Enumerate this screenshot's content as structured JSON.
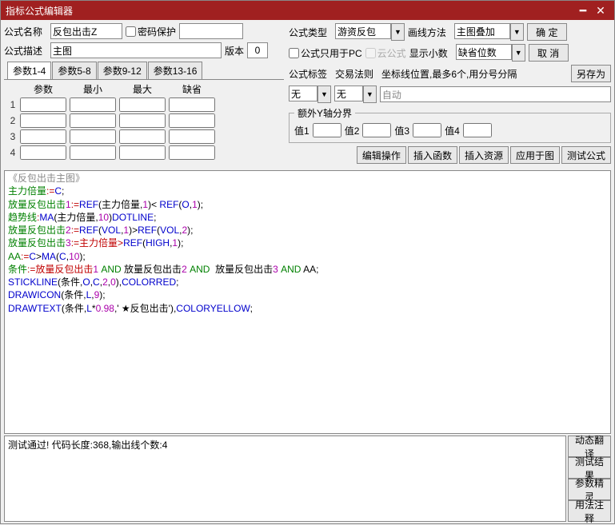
{
  "window": {
    "title": "指标公式编辑器"
  },
  "labels": {
    "name": "公式名称",
    "pwd": "密码保护",
    "type": "公式类型",
    "draw": "画线方法",
    "desc": "公式描述",
    "ver": "版本",
    "pcOnly": "公式只用于PC",
    "cloud": "云公式",
    "decimals": "显示小数",
    "tag": "公式标签",
    "tradeRule": "交易法则",
    "crosshair": "坐标线位置,最多6个,用分号分隔",
    "auto": "自动",
    "extraY": "额外Y轴分界",
    "v1": "值1",
    "v2": "值2",
    "v3": "值3",
    "v4": "值4"
  },
  "fields": {
    "name": "反包出击Z",
    "desc": "主图",
    "version": "0",
    "type": "游资反包",
    "draw": "主图叠加",
    "decimals": "缺省位数",
    "tag": "无",
    "tradeRule": "无"
  },
  "buttons": {
    "ok": "确 定",
    "cancel": "取 消",
    "saveAs": "另存为",
    "editOp": "编辑操作",
    "insFunc": "插入函数",
    "insRes": "插入资源",
    "applyTo": "应用于图",
    "test": "测试公式",
    "dynTrans": "动态翻译",
    "testResult": "测试结果",
    "paramWiz": "参数精灵",
    "usage": "用法注释"
  },
  "paramTabs": [
    "参数1-4",
    "参数5-8",
    "参数9-12",
    "参数13-16"
  ],
  "paramHeaders": [
    "参数",
    "最小",
    "最大",
    "缺省"
  ],
  "code": {
    "l1a": "《反包出击主图》",
    "l2a": "主力倍量",
    "l2b": ":=",
    "l2c": "C",
    "l2d": ";",
    "l3a": "放量反包出击",
    "l3b": "1",
    "l3c": ":=",
    "l3d": "REF",
    "l3e": "(主力倍量,",
    "l3f": "1",
    "l3g": ")< ",
    "l3h": "REF",
    "l3i": "(",
    "l3j": "O",
    "l3k": ",",
    "l3l": "1",
    "l3m": ");",
    "l4a": "趋势线",
    "l4b": ":",
    "l4c": "MA",
    "l4d": "(主力倍量,",
    "l4e": "10",
    "l4f": ")",
    "l4g": "DOTLINE",
    "l4h": ";",
    "l5a": "放量反包出击",
    "l5b": "2",
    "l5c": ":=",
    "l5d": "REF",
    "l5e": "(",
    "l5f": "VOL",
    "l5g": ",",
    "l5h": "1",
    "l5i": ")>",
    "l5j": "REF",
    "l5k": "(",
    "l5l": "VOL",
    "l5m": ",",
    "l5n": "2",
    "l5o": ");",
    "l6a": "放量反包出击",
    "l6b": "3",
    "l6c": ":=主力倍量>",
    "l6d": "REF",
    "l6e": "(",
    "l6f": "HIGH",
    "l6g": ",",
    "l6h": "1",
    "l6i": ");",
    "l7a": "AA",
    "l7b": ":=",
    "l7c": "C",
    "l7d": ">",
    "l7e": "MA",
    "l7f": "(",
    "l7g": "C",
    "l7h": ",",
    "l7i": "10",
    "l7j": ");",
    "l8a": "条件",
    "l8b": ":=放量反包出击",
    "l8c": "1",
    "l8d": " AND",
    "l8e": " 放量反包出击",
    "l8f": "2",
    "l8g": " AND ",
    "l8h": " 放量反包出击",
    "l8i": "3",
    "l8j": " AND",
    "l8k": " AA",
    "l8l": ";",
    "l9a": "STICKLINE",
    "l9b": "(条件,",
    "l9c": "O",
    "l9d": ",",
    "l9e": "C",
    "l9f": ",",
    "l9g": "2",
    "l9h": ",",
    "l9i": "0",
    "l9j": "),",
    "l9k": "COLORRED",
    "l9l": ";",
    "l10a": "DRAWICON",
    "l10b": "(条件,",
    "l10c": "L",
    "l10d": ",",
    "l10e": "9",
    "l10f": ");",
    "l11a": "DRAWTEXT",
    "l11b": "(条件,",
    "l11c": "L",
    "l11d": "*",
    "l11e": "0.98",
    "l11f": ",' ★反包出击'),",
    "l11g": "COLORYELLOW",
    "l11h": ";"
  },
  "status": "测试通过! 代码长度:368,输出线个数:4"
}
